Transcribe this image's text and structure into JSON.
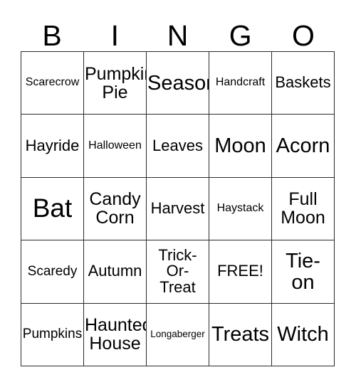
{
  "card": {
    "title_letters": [
      "B",
      "I",
      "N",
      "G",
      "O"
    ],
    "columns": 5,
    "rows": 5,
    "border_color": "#2a2a2a",
    "background_color": "#ffffff",
    "text_color": "#000000",
    "free_space_label": "FREE!",
    "free_space_position": "row4-col4"
  },
  "squares": [
    {
      "text": "Scarecrow",
      "size": "xs"
    },
    {
      "text": "Pumpkin\nPie",
      "size": "l"
    },
    {
      "text": "Season",
      "size": "xl"
    },
    {
      "text": "Handcraft",
      "size": "xs"
    },
    {
      "text": "Baskets",
      "size": "m"
    },
    {
      "text": "Hayride",
      "size": "m"
    },
    {
      "text": "Halloween",
      "size": "xs"
    },
    {
      "text": "Leaves",
      "size": "m"
    },
    {
      "text": "Moon",
      "size": "xl"
    },
    {
      "text": "Acorn",
      "size": "xl"
    },
    {
      "text": "Bat",
      "size": "xxl"
    },
    {
      "text": "Candy\nCorn",
      "size": "l"
    },
    {
      "text": "Harvest",
      "size": "m"
    },
    {
      "text": "Haystack",
      "size": "xs"
    },
    {
      "text": "Full\nMoon",
      "size": "l"
    },
    {
      "text": "Scaredy",
      "size": "s"
    },
    {
      "text": "Autumn",
      "size": "m"
    },
    {
      "text": "Trick-\nOr-\nTreat",
      "size": "m"
    },
    {
      "text": "FREE!",
      "size": "m"
    },
    {
      "text": "Tie-\non",
      "size": "xl"
    },
    {
      "text": "Pumpkins",
      "size": "s"
    },
    {
      "text": "Haunted\nHouse",
      "size": "l"
    },
    {
      "text": "Longaberger",
      "size": "xxs"
    },
    {
      "text": "Treats",
      "size": "xl"
    },
    {
      "text": "Witch",
      "size": "xl"
    }
  ]
}
